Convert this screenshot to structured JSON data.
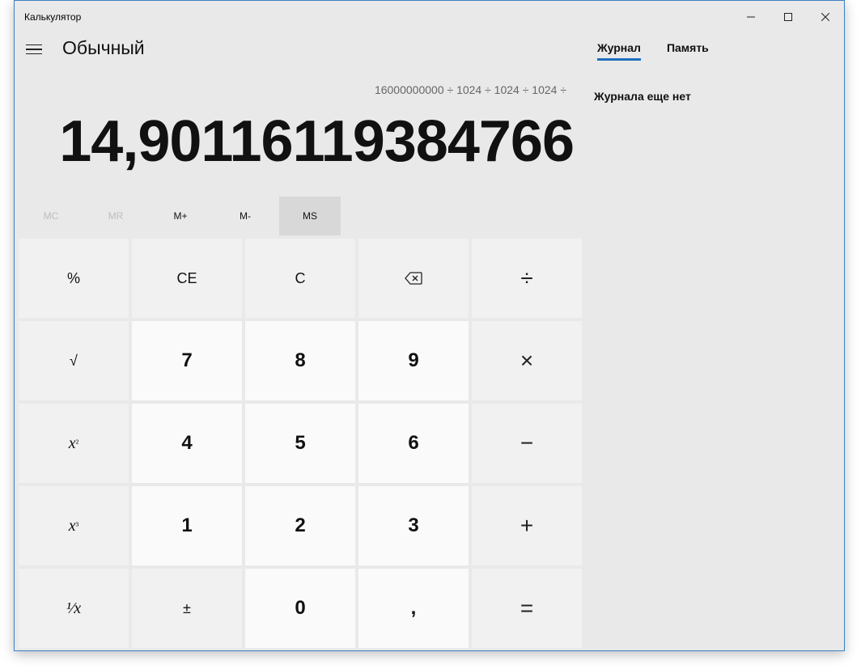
{
  "window": {
    "title": "Калькулятор",
    "minimize_icon": "minimize-icon",
    "maximize_icon": "maximize-icon",
    "close_icon": "close-icon"
  },
  "header": {
    "menu_icon": "hamburger-menu-icon",
    "mode": "Обычный"
  },
  "display": {
    "expression": "16000000000 ÷ 1024 ÷ 1024 ÷ 1024 ÷",
    "result": "14,90116119384766"
  },
  "memory": [
    {
      "label": "MC",
      "enabled": false
    },
    {
      "label": "MR",
      "enabled": false
    },
    {
      "label": "M+",
      "enabled": true
    },
    {
      "label": "M-",
      "enabled": true
    },
    {
      "label": "MS",
      "enabled": true
    }
  ],
  "keypad": {
    "percent": "%",
    "ce": "CE",
    "c": "C",
    "backspace_icon": "backspace-icon",
    "divide": "÷",
    "sqrt": "√",
    "k7": "7",
    "k8": "8",
    "k9": "9",
    "multiply": "×",
    "square_base": "x",
    "square_exp": "²",
    "k4": "4",
    "k5": "5",
    "k6": "6",
    "minus": "−",
    "cube_base": "x",
    "cube_exp": "³",
    "k1": "1",
    "k2": "2",
    "k3": "3",
    "plus": "+",
    "reciprocal": "¹⁄x",
    "negate": "±",
    "k0": "0",
    "decimal": ",",
    "equals": "="
  },
  "sidebar": {
    "tabs": [
      {
        "label": "Журнал",
        "active": true
      },
      {
        "label": "Память",
        "active": false
      }
    ],
    "empty_message": "Журнала еще нет"
  },
  "colors": {
    "accent": "#1f6fbf",
    "background": "#e9e9e9",
    "number_key": "#fafafa",
    "function_key": "#f1f1f1"
  }
}
